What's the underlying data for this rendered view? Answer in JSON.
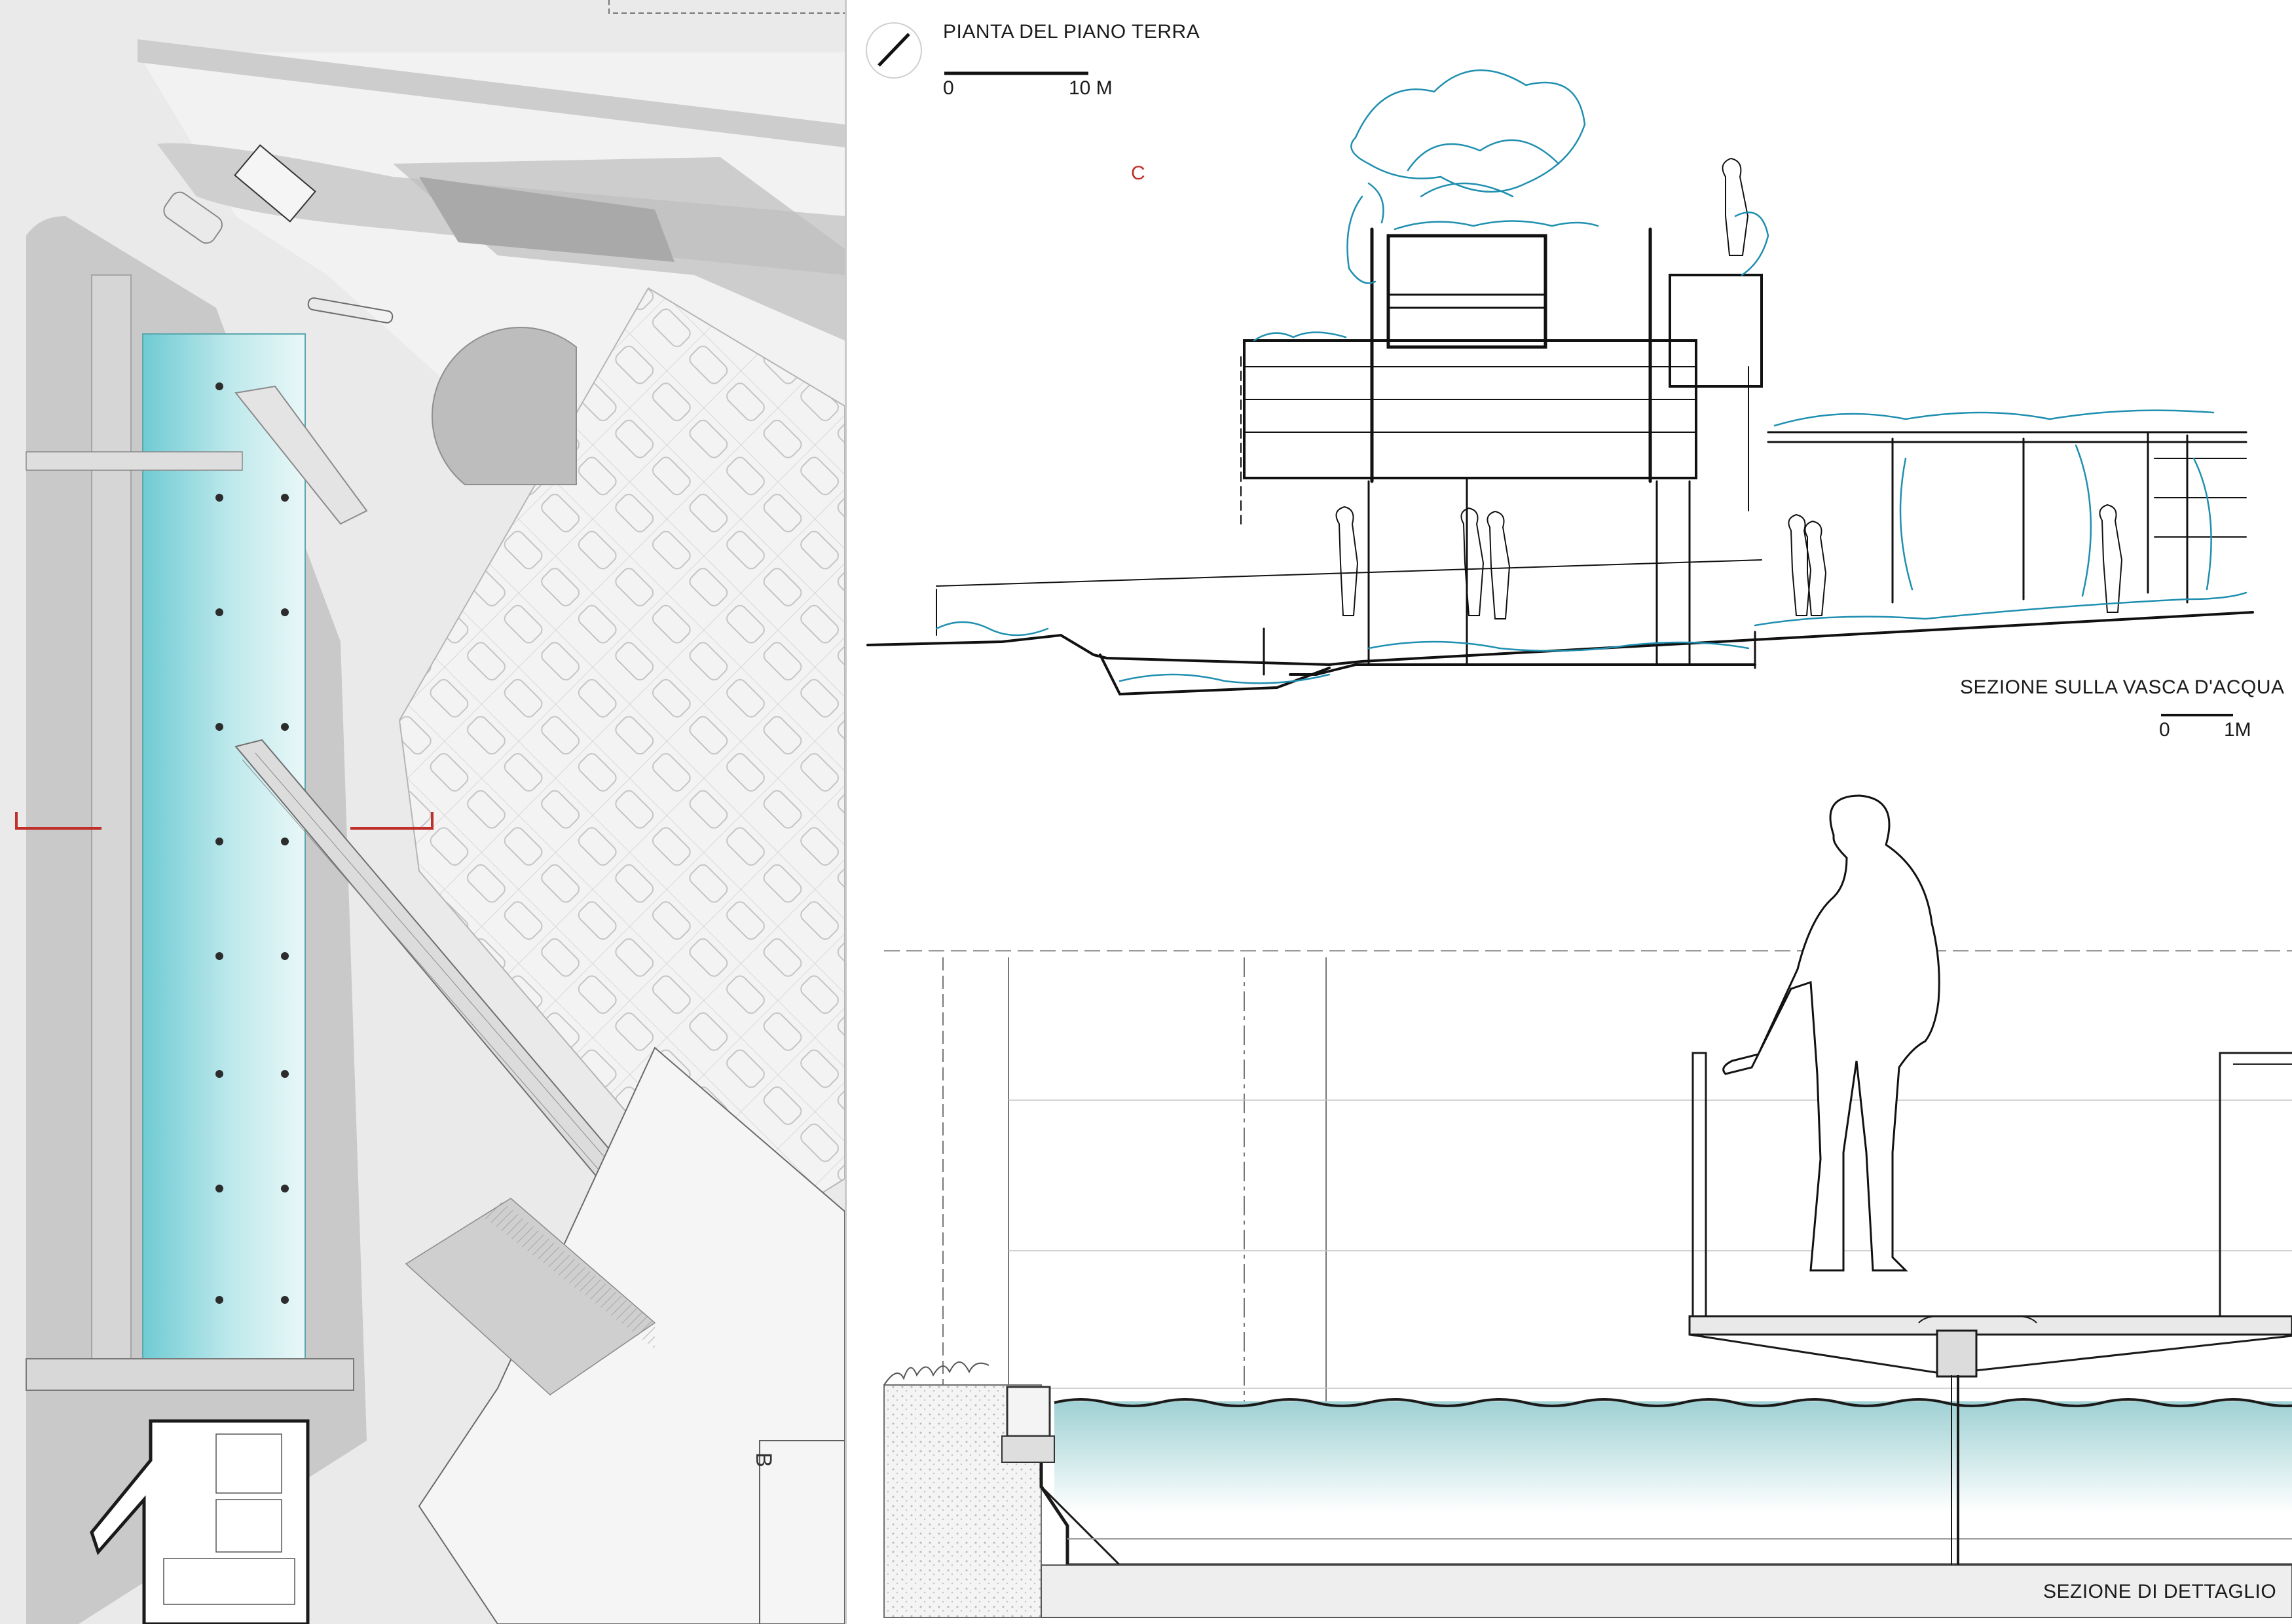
{
  "plan": {
    "title": "PIANTA DEL PIANO TERRA",
    "scale": {
      "start": "0",
      "end": "10 M"
    },
    "marks": {
      "c": "C",
      "b": "B"
    },
    "colors": {
      "water": "#7fd3d9",
      "ground": "#e6e6e6",
      "road": "#c8c8c8",
      "section_mark": "#c0302a"
    }
  },
  "section_water": {
    "title": "SEZIONE SULLA VASCA D'ACQUA",
    "scale": {
      "start": "0",
      "end": "1M"
    },
    "colors": {
      "vegetation": "#1f8fb0",
      "line": "#111111"
    }
  },
  "section_detail": {
    "title": "SEZIONE DI DETTAGLIO",
    "colors": {
      "water_top": "#a6d7d9",
      "water_bottom": "#ffffff",
      "line": "#1a1a1a"
    }
  }
}
